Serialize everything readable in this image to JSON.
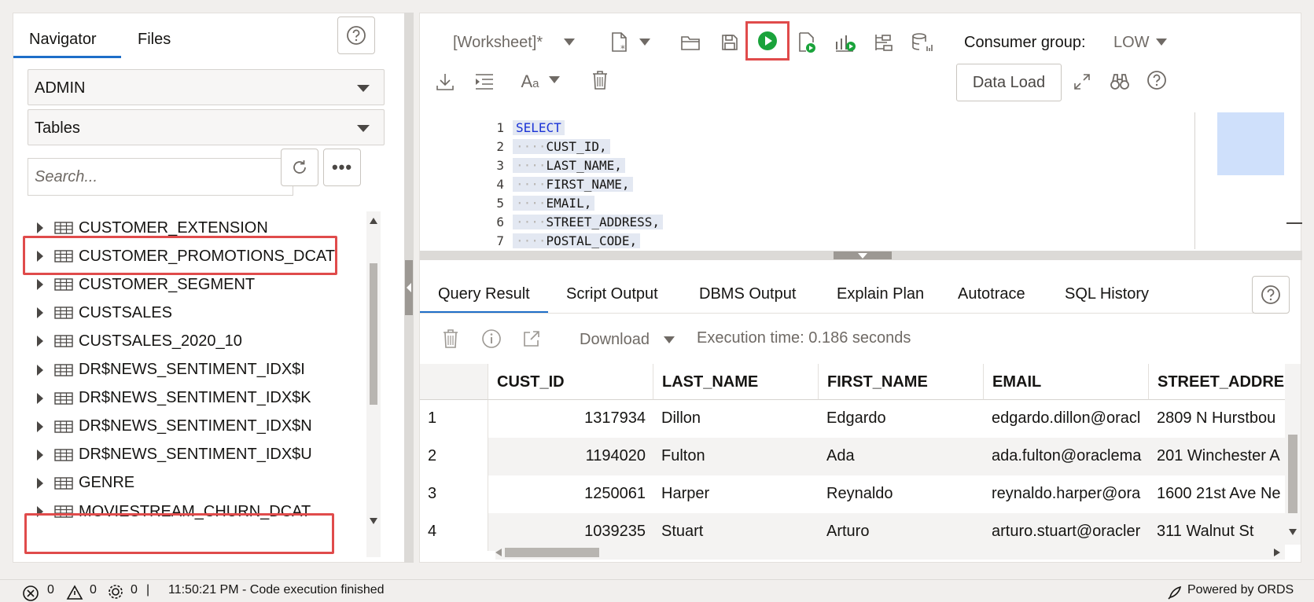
{
  "navigator": {
    "tabs": [
      "Navigator",
      "Files"
    ],
    "schema": "ADMIN",
    "object_type": "Tables",
    "search_placeholder": "Search...",
    "tables": [
      "CUSTOMER_EXTENSION",
      "CUSTOMER_PROMOTIONS_DCAT",
      "CUSTOMER_SEGMENT",
      "CUSTSALES",
      "CUSTSALES_2020_10",
      "DR$NEWS_SENTIMENT_IDX$I",
      "DR$NEWS_SENTIMENT_IDX$K",
      "DR$NEWS_SENTIMENT_IDX$N",
      "DR$NEWS_SENTIMENT_IDX$U",
      "GENRE",
      "MOVIESTREAM_CHURN_DCAT"
    ]
  },
  "toolbar": {
    "worksheet": "[Worksheet]*",
    "consumer_group_label": "Consumer group:",
    "consumer_group_value": "LOW",
    "data_load": "Data Load",
    "run_color": "#1aa33b",
    "highlight_color": "#e04b4b"
  },
  "editor": {
    "line_numbers": [
      "1",
      "2",
      "3",
      "4",
      "5",
      "6",
      "7"
    ],
    "lines": [
      "SELECT",
      "CUST_ID,",
      "LAST_NAME,",
      "FIRST_NAME,",
      "EMAIL,",
      "STREET_ADDRESS,",
      "POSTAL_CODE,"
    ]
  },
  "results": {
    "tabs": [
      "Query Result",
      "Script Output",
      "DBMS Output",
      "Explain Plan",
      "Autotrace",
      "SQL History"
    ],
    "download": "Download",
    "execution_time": "Execution time: 0.186 seconds",
    "columns": [
      "CUST_ID",
      "LAST_NAME",
      "FIRST_NAME",
      "EMAIL",
      "STREET_ADDRES"
    ],
    "rows": [
      [
        "1",
        "1317934",
        "Dillon",
        "Edgardo",
        "edgardo.dillon@oracl",
        "2809 N Hurstbou"
      ],
      [
        "2",
        "1194020",
        "Fulton",
        "Ada",
        "ada.fulton@oraclema",
        "201 Winchester A"
      ],
      [
        "3",
        "1250061",
        "Harper",
        "Reynaldo",
        "reynaldo.harper@ora",
        "1600 21st Ave Ne"
      ],
      [
        "4",
        "1039235",
        "Stuart",
        "Arturo",
        "arturo.stuart@oracler",
        "311 Walnut St"
      ]
    ]
  },
  "status": {
    "errors": "0",
    "warnings": "0",
    "jobs": "0",
    "time_message": "11:50:21 PM - Code execution finished",
    "powered_by": "Powered by ORDS"
  }
}
